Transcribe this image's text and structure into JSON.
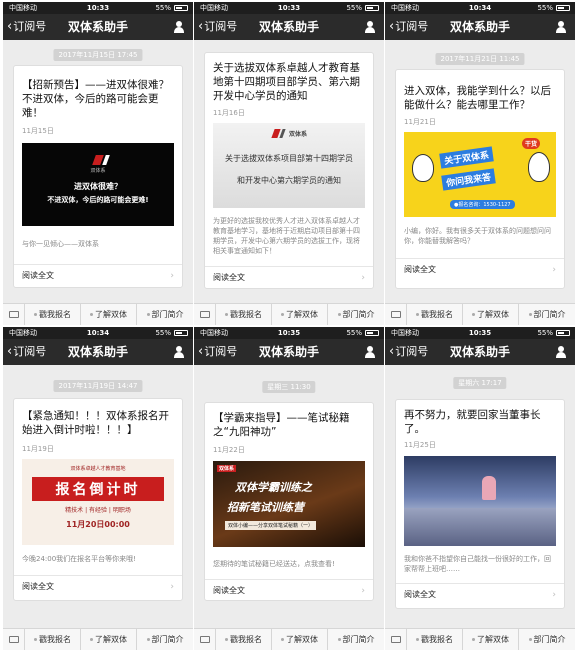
{
  "common": {
    "carrier": "中国移动",
    "battery": "55%",
    "back_label": "订阅号",
    "nav_title": "双体系助手",
    "read_label": "阅读全文",
    "tabs": [
      "戳我报名",
      "了解双体",
      "部门简介"
    ]
  },
  "panels": [
    {
      "time": "10:33",
      "timestamp": "2017年11月15日 17:45",
      "title": "【招新预告】——进双体很难？不进双体，今后的路可能会更难！",
      "date": "11月15日",
      "desc": "与你一见倾心——双体系",
      "image": {
        "logo": "双体系",
        "line1": "进双体很难？",
        "line2": "不进双体，今后的路可能会更难!"
      }
    },
    {
      "time": "10:33",
      "timestamp": "",
      "title": "关于选拔双体系卓越人才教育基地第十四期项目部学员、第六期开发中心学员的通知",
      "date": "11月16日",
      "desc": "为更好的选拔我校优秀人才进入双体系卓越人才教育基地学习，基地将于近期启动项目部第十四期学员，开发中心第六期学员的选拔工作，现将相关事宜通知如下！",
      "image": {
        "logo": "双体系",
        "line1": "关于选拔双体系项目部第十四期学员",
        "line2": "和开发中心第六期学员的通知"
      }
    },
    {
      "time": "10:34",
      "timestamp": "2017年11月21日 11:45",
      "title": "进入双体，我能学到什么？以后能做什么？能去哪里工作？",
      "date": "11月21日",
      "desc": "小编，你好。我有很多关于双体系的问题想问问你，你能替我解答吗？",
      "image": {
        "tag": "干货",
        "line1": "关于双体系",
        "line2": "你问我来答",
        "line3": "●报名咨询：1530-1127"
      }
    },
    {
      "time": "10:34",
      "timestamp": "2017年11月19日 14:47",
      "title": "【紧急通知！！！双体系报名开始进入倒计时啦！！！】",
      "date": "11月19日",
      "desc": "今晚24:00我们在报名平台等你来哦!",
      "image": {
        "top": "双体系卓越人才教育基地",
        "big": "报名倒计时",
        "mid": "精技术 | 有经验 | 明职场",
        "date": "11月20日00:00"
      }
    },
    {
      "time": "10:35",
      "timestamp": "星期三 11:30",
      "title": "【学霸来指导】——笔试秘籍之“九阳神功”",
      "date": "11月22日",
      "desc": "您期待的笔试秘籍已经送达，点我查看!",
      "image": {
        "logo": "双体系",
        "line1": "双体学霸训练之",
        "line2": "招新笔试训练营",
        "line3": "双体小编——分享双体笔试秘籍（一）"
      }
    },
    {
      "time": "10:35",
      "timestamp": "星期六 17:17",
      "title": "再不努力，就要回家当董事长了。",
      "date": "11月25日",
      "desc": "我和你爸不指望你自己能找一份很好的工作，回家帮帮上班吧……",
      "image": {}
    }
  ],
  "colors": {
    "navbar": "#2b2b2b",
    "statusbar": "#1e1e1e",
    "background": "#ececec",
    "accent_red": "#c81e1e",
    "accent_yellow": "#f7d31b"
  }
}
